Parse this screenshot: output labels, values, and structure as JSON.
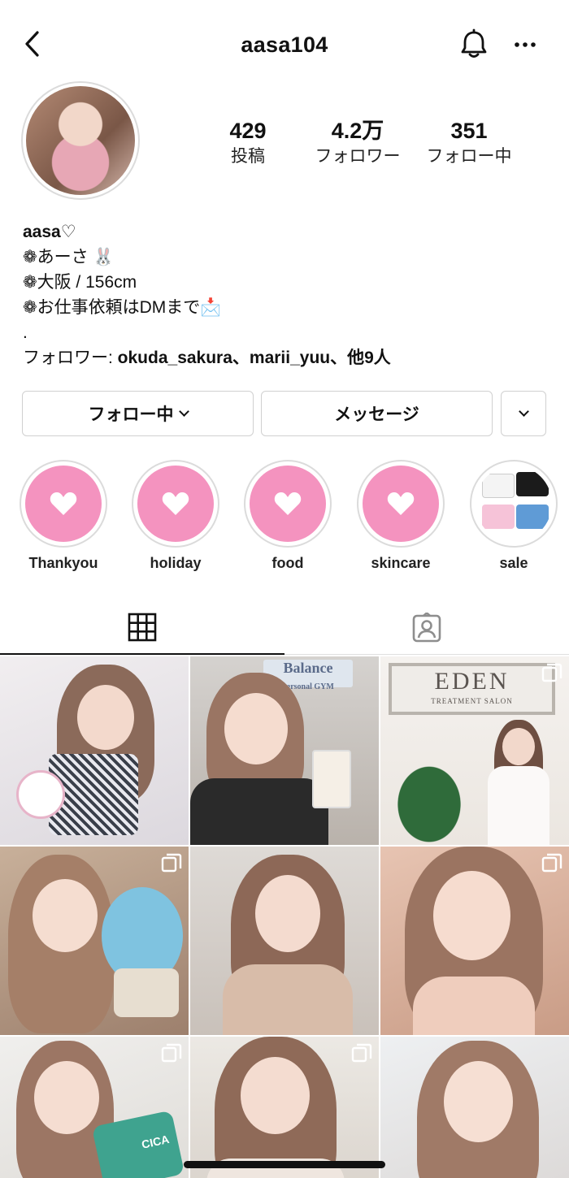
{
  "header": {
    "username": "aasa104",
    "back_icon": "chevron-left-icon",
    "bell_icon": "bell-icon",
    "more_icon": "ellipsis-icon"
  },
  "profile": {
    "stats": [
      {
        "num": "429",
        "label": "投稿"
      },
      {
        "num": "4.2万",
        "label": "フォロワー"
      },
      {
        "num": "351",
        "label": "フォロー中"
      }
    ],
    "display_name": "aasa♡",
    "bio_lines": [
      "❁あーさ 🐰",
      "❁大阪 / 156cm",
      "❁お仕事依頼はDMまで📩",
      "."
    ],
    "followed_by_prefix": "フォロワー: ",
    "followed_by_names": "okuda_sakura、marii_yuu、他9人"
  },
  "actions": {
    "following_label": "フォロー中",
    "message_label": "メッセージ"
  },
  "highlights": [
    {
      "label": "Thankyou"
    },
    {
      "label": "holiday"
    },
    {
      "label": "food"
    },
    {
      "label": "skincare"
    },
    {
      "label": "sale"
    }
  ],
  "tabs": [
    {
      "icon": "grid-icon",
      "selected": true
    },
    {
      "icon": "tagged-person-icon",
      "selected": false
    }
  ],
  "posts": [
    {
      "multi": false,
      "bg": "#e9e4e6"
    },
    {
      "multi": false,
      "bg": "#cfc8c2",
      "sign_text": "Balance",
      "sign_sub": "personal GYM"
    },
    {
      "multi": true,
      "bg": "#f2efec",
      "sign_text": "EDEN",
      "sign_sub": "TREATMENT SALON"
    },
    {
      "multi": true,
      "bg": "#b7a08e"
    },
    {
      "multi": false,
      "bg": "#d8d2cc"
    },
    {
      "multi": true,
      "bg": "#d9b8a6"
    },
    {
      "multi": true,
      "bg": "#e8e6e2",
      "product_text": "CICA"
    },
    {
      "multi": true,
      "bg": "#e4ded8"
    },
    {
      "multi": false,
      "bg": "#e9e6e8"
    }
  ],
  "colors": {
    "highlight_pink": "#f493bf",
    "border": "#dbdbdb"
  }
}
